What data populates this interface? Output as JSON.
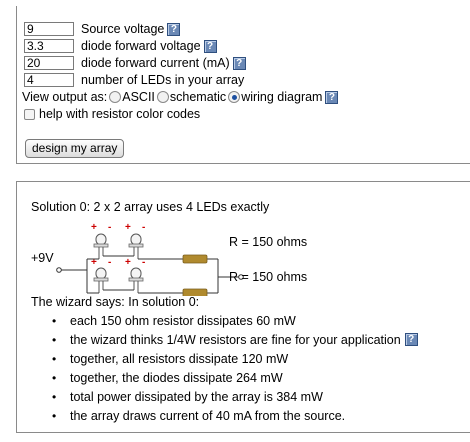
{
  "form": {
    "fields": [
      {
        "value": "9",
        "label": "Source voltage",
        "has_help": true
      },
      {
        "value": "3.3",
        "label": "diode forward voltage",
        "has_help": true
      },
      {
        "value": "20",
        "label": "diode forward current (mA)",
        "has_help": true
      },
      {
        "value": "4",
        "label": "number of LEDs in your array",
        "has_help": false
      }
    ],
    "view_output_label": "View output as:",
    "options": [
      {
        "label": "ASCII",
        "selected": false
      },
      {
        "label": "schematic",
        "selected": false
      },
      {
        "label": "wiring diagram",
        "selected": true
      }
    ],
    "color_codes_label": "help with resistor color codes",
    "color_codes_checked": false,
    "design_button_label": "design my array",
    "help_glyph": "?"
  },
  "result": {
    "title": "Solution 0: 2 x 2 array uses 4 LEDs exactly",
    "supply_label": "+9V",
    "plus_sign": "+",
    "minus_sign": "-",
    "resistor_labels": [
      "R = 150 ohms",
      "R = 150 ohms"
    ],
    "says_title": "The wizard says: In solution 0:",
    "bullets": [
      "each 150 ohm resistor dissipates 60 mW",
      "the wizard thinks 1/4W resistors are fine for your application",
      "together, all resistors dissipate 120 mW",
      "together, the diodes dissipate 264 mW",
      "total power dissipated by the array is 384 mW",
      "the array draws current of 40 mA from the source."
    ],
    "help_bullet_index": 1
  },
  "colors": {
    "help_icon": "#6a88b5",
    "plus": "#cc0000",
    "resistor": "#b08a2e",
    "wire": "#333333"
  }
}
